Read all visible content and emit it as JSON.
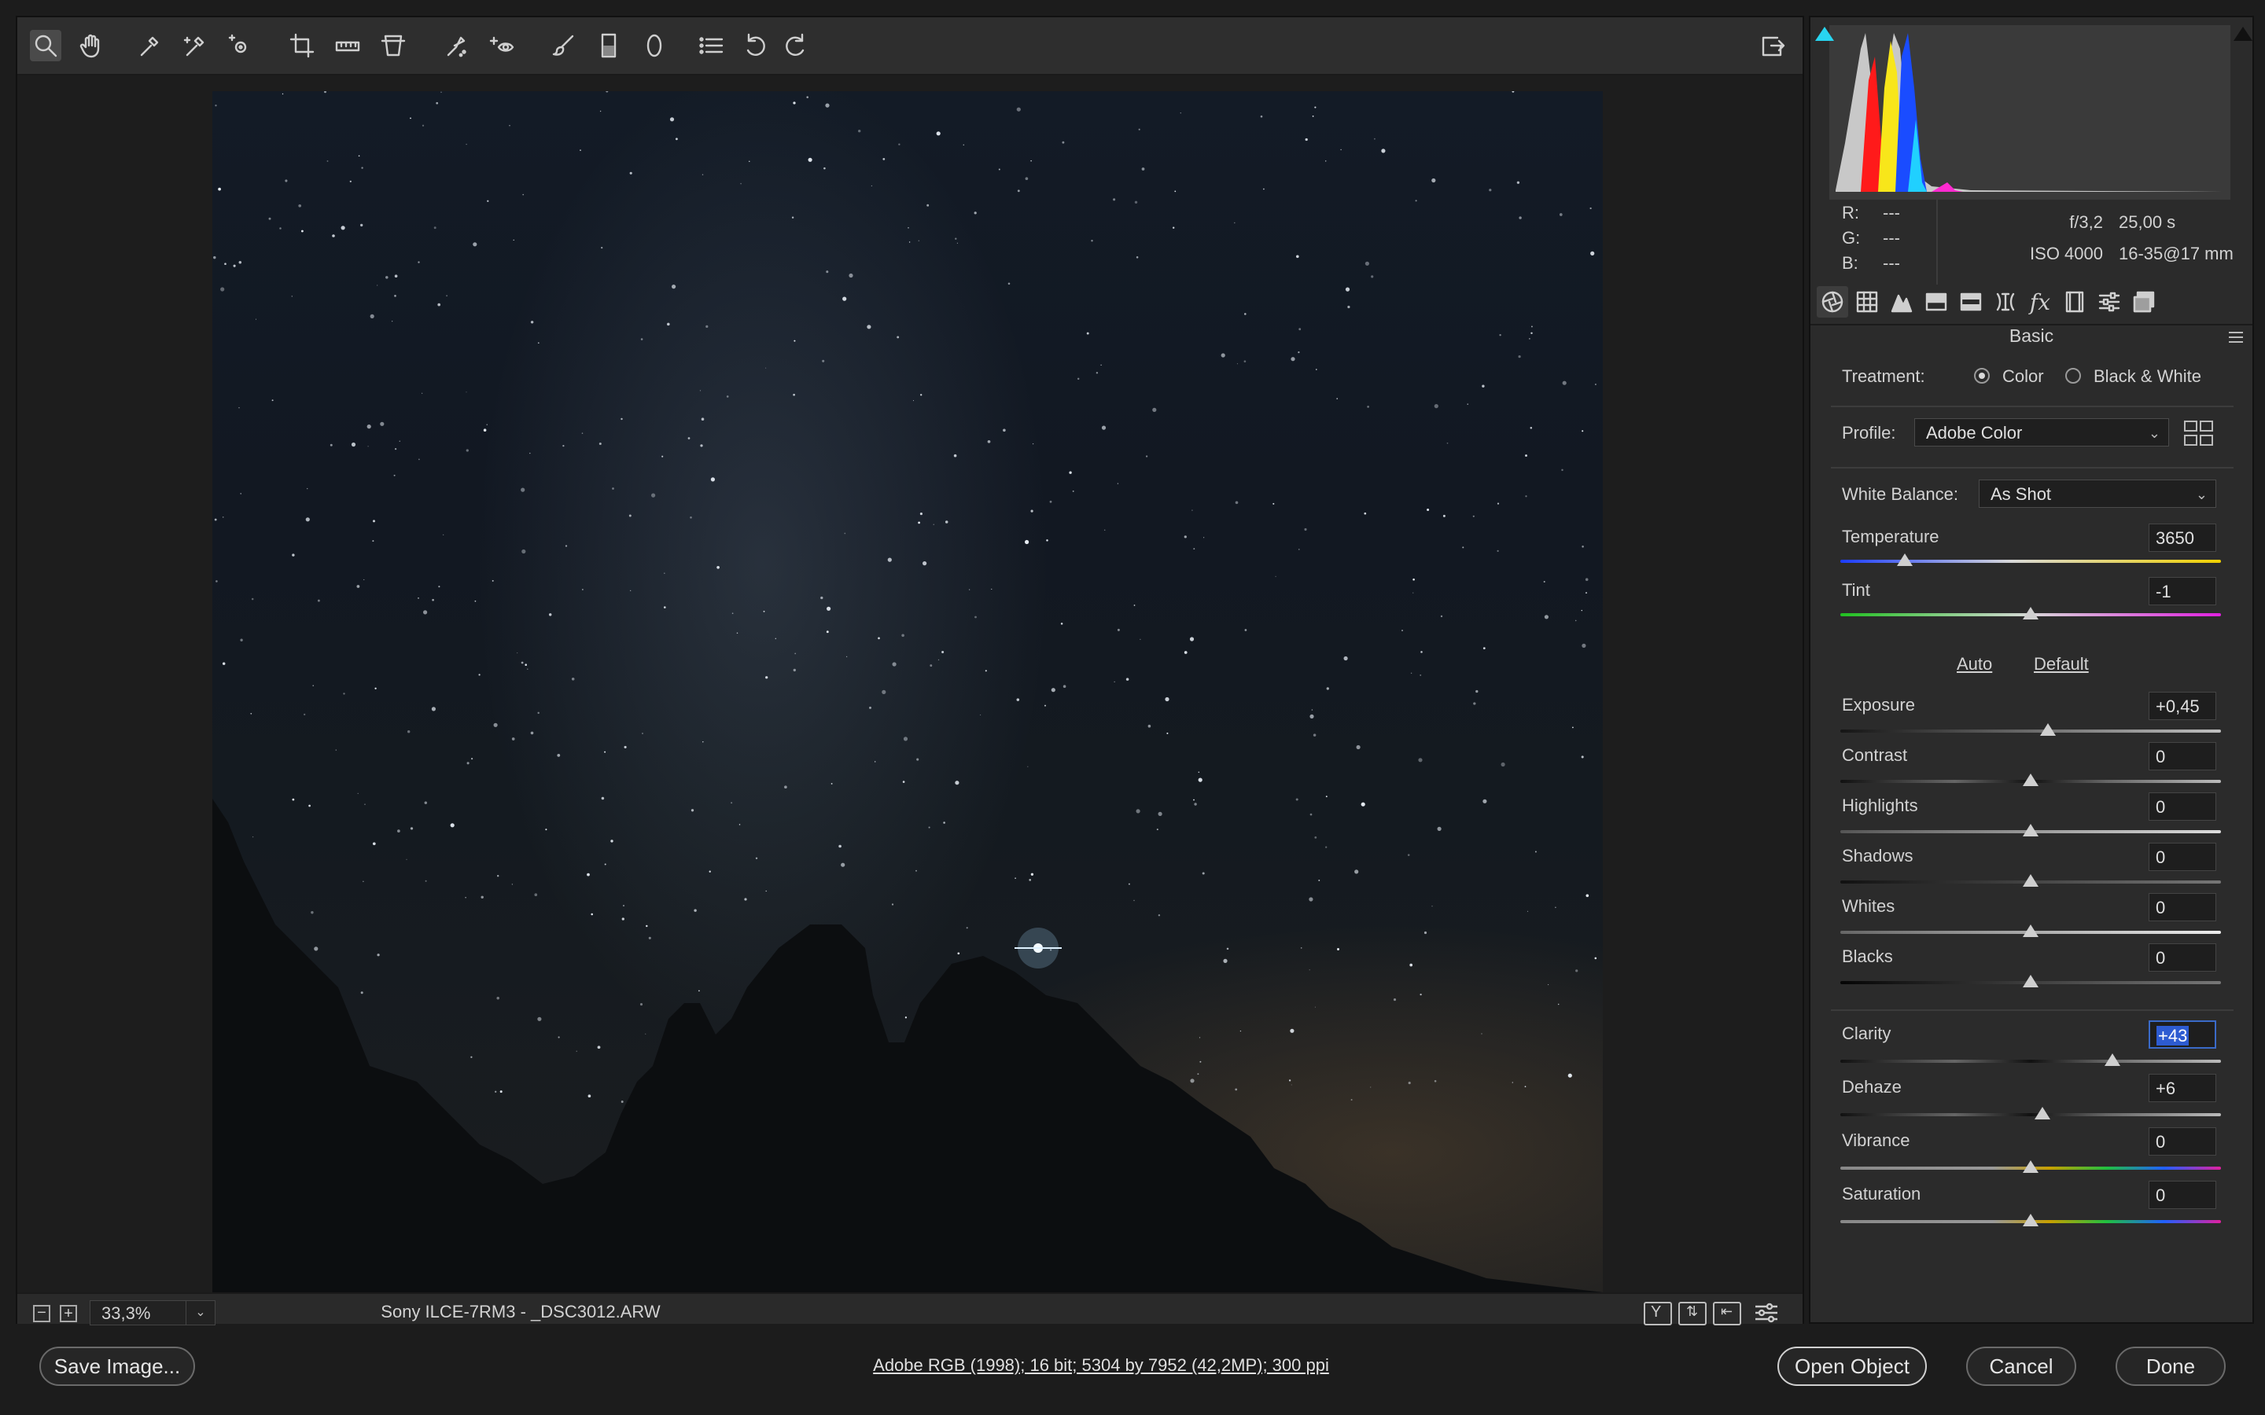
{
  "toolbar": {
    "tools": [
      "zoom-tool",
      "hand-tool",
      "white-balance-tool",
      "color-sampler-tool",
      "targeted-adjustment-tool",
      "crop-tool",
      "straighten-tool",
      "transform-tool",
      "spot-removal-tool",
      "red-eye-tool",
      "adjustment-brush-tool",
      "graduated-filter-tool",
      "radial-filter-tool",
      "presets-list-tool",
      "rotate-ccw-tool",
      "rotate-cw-tool"
    ],
    "fullscreen_icon": "export-icon"
  },
  "canvas": {
    "zoom_value": "33,3%",
    "filename": "Sony ILCE-7RM3  -  _DSC3012.ARW"
  },
  "histogram": {
    "channels": [
      "red",
      "green",
      "blue"
    ],
    "clip_left_color": "#28d5f0",
    "clip_right_color": "#111111"
  },
  "readout": {
    "r_label": "R:",
    "r_value": "---",
    "g_label": "G:",
    "g_value": "---",
    "b_label": "B:",
    "b_value": "---",
    "aperture": "f/3,2",
    "shutter": "25,00 s",
    "iso": "ISO 4000",
    "lens": "16-35@17 mm"
  },
  "panel": {
    "title": "Basic",
    "treatment_label": "Treatment:",
    "treatment_color": "Color",
    "treatment_bw": "Black & White",
    "profile_label": "Profile:",
    "profile_value": "Adobe Color",
    "wb_label": "White Balance:",
    "wb_value": "As Shot",
    "auto_label": "Auto",
    "default_label": "Default",
    "sliders": [
      {
        "name": "Temperature",
        "value": "3650",
        "position": 0.17
      },
      {
        "name": "Tint",
        "value": "-1",
        "position": 0.5
      },
      {
        "name": "Exposure",
        "value": "+0,45",
        "position": 0.545
      },
      {
        "name": "Contrast",
        "value": "0",
        "position": 0.5
      },
      {
        "name": "Highlights",
        "value": "0",
        "position": 0.5
      },
      {
        "name": "Shadows",
        "value": "0",
        "position": 0.5
      },
      {
        "name": "Whites",
        "value": "0",
        "position": 0.5
      },
      {
        "name": "Blacks",
        "value": "0",
        "position": 0.5
      },
      {
        "name": "Clarity",
        "value": "+43",
        "position": 0.715
      },
      {
        "name": "Dehaze",
        "value": "+6",
        "position": 0.53
      },
      {
        "name": "Vibrance",
        "value": "0",
        "position": 0.5
      },
      {
        "name": "Saturation",
        "value": "0",
        "position": 0.5
      }
    ]
  },
  "footer": {
    "save_label": "Save Image...",
    "info_link": "Adobe RGB (1998); 16 bit; 5304 by 7952 (42,2MP); 300 ppi",
    "open_label": "Open Object",
    "cancel_label": "Cancel",
    "done_label": "Done"
  }
}
